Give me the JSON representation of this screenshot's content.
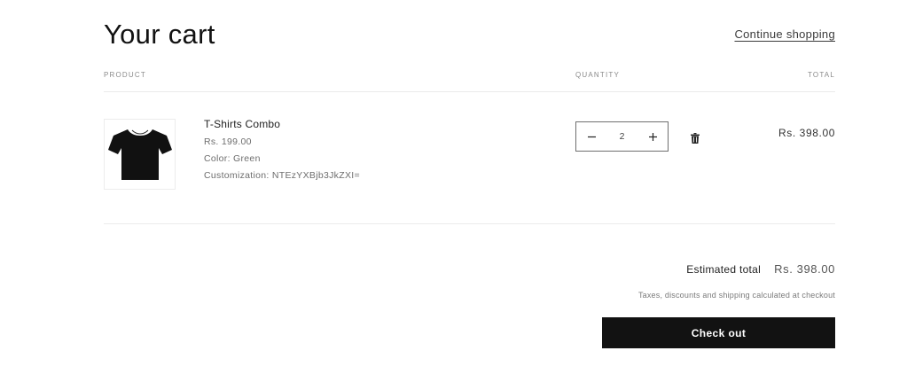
{
  "header": {
    "title": "Your cart",
    "continue_label": "Continue shopping"
  },
  "table": {
    "headers": {
      "product": "PRODUCT",
      "quantity": "QUANTITY",
      "total": "TOTAL"
    }
  },
  "items": [
    {
      "name": "T-Shirts Combo",
      "price": "Rs. 199.00",
      "color": "Color: Green",
      "customization": "Customization: NTEzYXBjb3JkZXI=",
      "quantity": "2",
      "line_total": "Rs. 398.00",
      "image_icon": "tshirt-image",
      "remove_icon": "trash-icon"
    }
  ],
  "summary": {
    "estimated_label": "Estimated total",
    "estimated_value": "Rs. 398.00",
    "tax_note": "Taxes, discounts and shipping calculated at checkout",
    "checkout_label": "Check out"
  },
  "colors": {
    "primary": "#121212",
    "background": "#ffffff"
  }
}
